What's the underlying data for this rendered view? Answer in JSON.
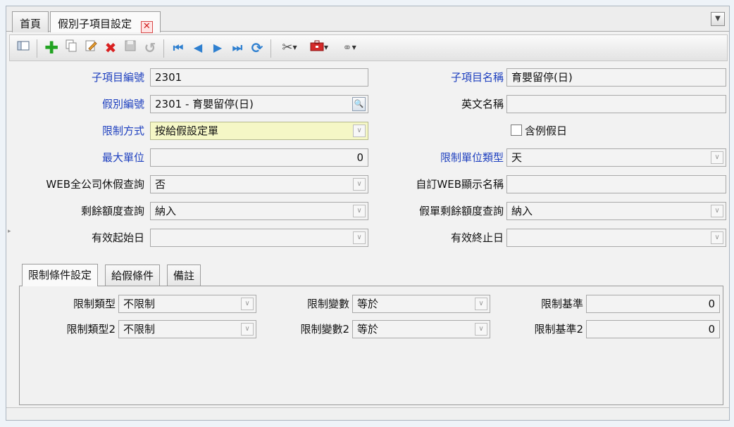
{
  "tabs": [
    {
      "label": "首頁"
    },
    {
      "label": "假別子項目設定"
    }
  ],
  "toolbar": {
    "icons": [
      "toggle-panel-icon",
      "add-icon",
      "copy-icon",
      "edit-icon",
      "delete-icon",
      "save-icon",
      "undo-icon",
      "first-record-icon",
      "prev-record-icon",
      "next-record-icon",
      "last-record-icon",
      "refresh-icon",
      "tools-icon",
      "toolbox-icon",
      "link-icon"
    ]
  },
  "form": {
    "sub_item_no": {
      "label": "子項目編號",
      "value": "2301"
    },
    "sub_item_name": {
      "label": "子項目名稱",
      "value": "育嬰留停(日)"
    },
    "leave_type_no": {
      "label": "假別編號",
      "value": "2301 - 育嬰留停(日)"
    },
    "english_name": {
      "label": "英文名稱",
      "value": ""
    },
    "restrict_method": {
      "label": "限制方式",
      "value": "按給假設定單"
    },
    "include_holiday": {
      "label": "含例假日",
      "checked": false
    },
    "max_unit": {
      "label": "最大單位",
      "value": "0"
    },
    "restrict_unit_type": {
      "label": "限制單位類型",
      "value": "天"
    },
    "web_company_query": {
      "label": "WEB全公司休假查詢",
      "value": "否"
    },
    "custom_web_name": {
      "label": "自訂WEB顯示名稱",
      "value": ""
    },
    "remaining_query": {
      "label": "剩餘額度查詢",
      "value": "納入"
    },
    "form_remaining_query": {
      "label": "假單剩餘額度查詢",
      "value": "納入"
    },
    "effective_start": {
      "label": "有效起始日",
      "value": ""
    },
    "effective_end": {
      "label": "有效終止日",
      "value": ""
    }
  },
  "subtabs": [
    {
      "label": "限制條件設定"
    },
    {
      "label": "給假條件"
    },
    {
      "label": "備註"
    }
  ],
  "conditions": {
    "row1": {
      "type_label": "限制類型",
      "type_value": "不限制",
      "var_label": "限制變數",
      "var_value": "等於",
      "base_label": "限制基準",
      "base_value": "0"
    },
    "row2": {
      "type_label": "限制類型2",
      "type_value": "不限制",
      "var_label": "限制變數2",
      "var_value": "等於",
      "base_label": "限制基準2",
      "base_value": "0"
    }
  },
  "colors": {
    "label_blue": "#1d3fbf",
    "highlight_field": "#f5f7c6"
  }
}
